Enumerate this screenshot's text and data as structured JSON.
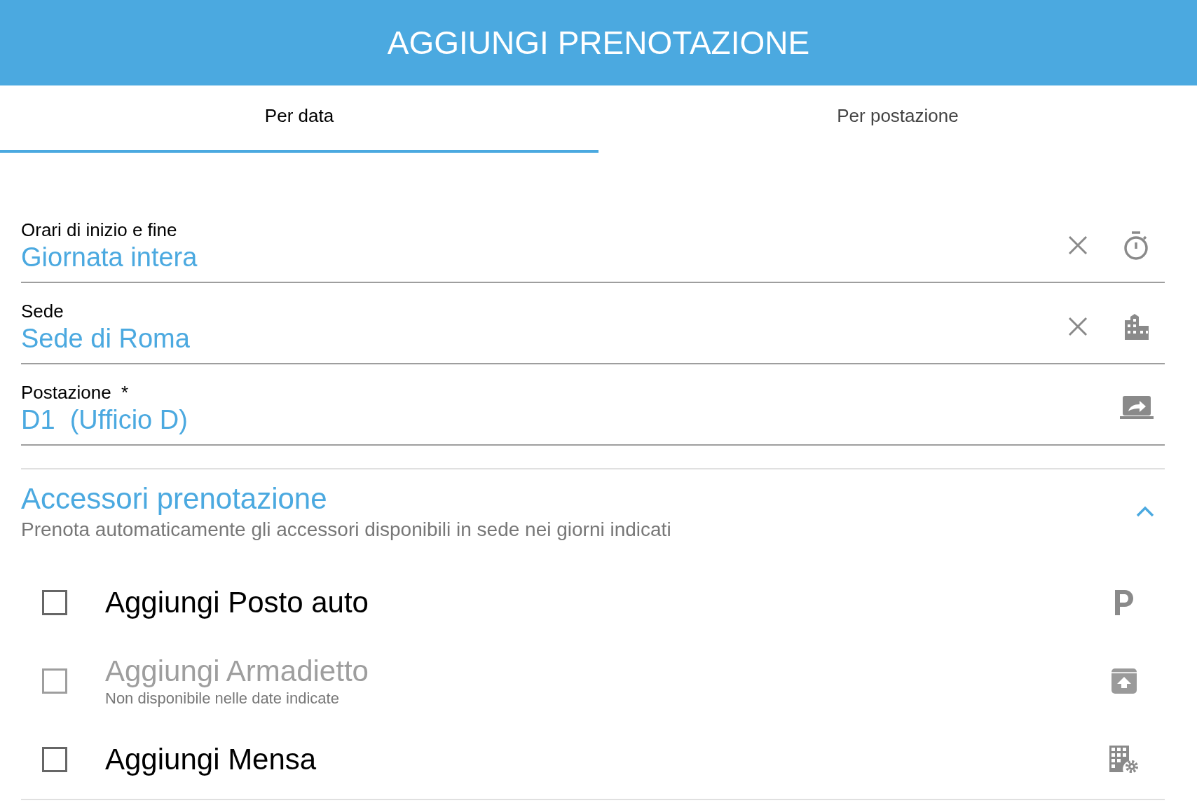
{
  "header": {
    "title": "AGGIUNGI PRENOTAZIONE"
  },
  "tabs": [
    {
      "label": "Per data",
      "selected": true
    },
    {
      "label": "Per postazione",
      "selected": false
    }
  ],
  "fields": [
    {
      "label": "Orari di inizio e fine",
      "value": "Giornata intera",
      "clearable": true
    },
    {
      "label": "Sede",
      "value": "Sede di Roma",
      "clearable": true
    },
    {
      "label": "Postazione  *",
      "value": "D1  (Ufficio D)",
      "clearable": false
    }
  ],
  "accessories": {
    "title": "Accessori prenotazione",
    "subtitle": "Prenota automaticamente gli accessori disponibili in sede nei giorni indicati",
    "expanded": true,
    "items": [
      {
        "label": "Aggiungi Posto auto",
        "checked": false,
        "disabled": false
      },
      {
        "label": "Aggiungi Armadietto",
        "note": "Non disponibile nelle date indicate",
        "checked": false,
        "disabled": true
      },
      {
        "label": "Aggiungi Mensa",
        "checked": false,
        "disabled": false
      }
    ]
  }
}
